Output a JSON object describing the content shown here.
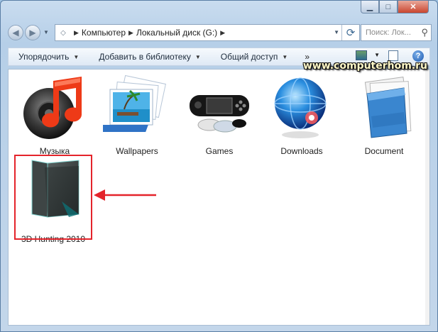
{
  "window": {
    "caption_buttons": {
      "minimize": "▁",
      "maximize": "□",
      "close": "✕"
    }
  },
  "nav": {
    "back_icon": "arrow-left-icon",
    "forward_icon": "arrow-right-icon",
    "breadcrumbs": [
      "Компьютер",
      "Локальный диск (G:)"
    ],
    "search_placeholder": "Поиск: Лок..."
  },
  "toolbar": {
    "organize": "Упорядочить",
    "add_library": "Добавить в библиотеку",
    "share": "Общий доступ",
    "more": "»",
    "help": "?"
  },
  "watermark": "www.computerhom.ru",
  "folders": [
    {
      "label": "Музыка",
      "icon": "music-note-icon"
    },
    {
      "label": "Wallpapers",
      "icon": "pictures-icon"
    },
    {
      "label": "Games",
      "icon": "game-console-icon"
    },
    {
      "label": "Downloads",
      "icon": "globe-icon"
    },
    {
      "label": "Document",
      "icon": "document-folder-icon"
    },
    {
      "label": "3D Hunting 2010",
      "icon": "dark-folder-icon"
    }
  ],
  "colors": {
    "highlight": "#e4242b",
    "accent": "#3f6b95"
  }
}
